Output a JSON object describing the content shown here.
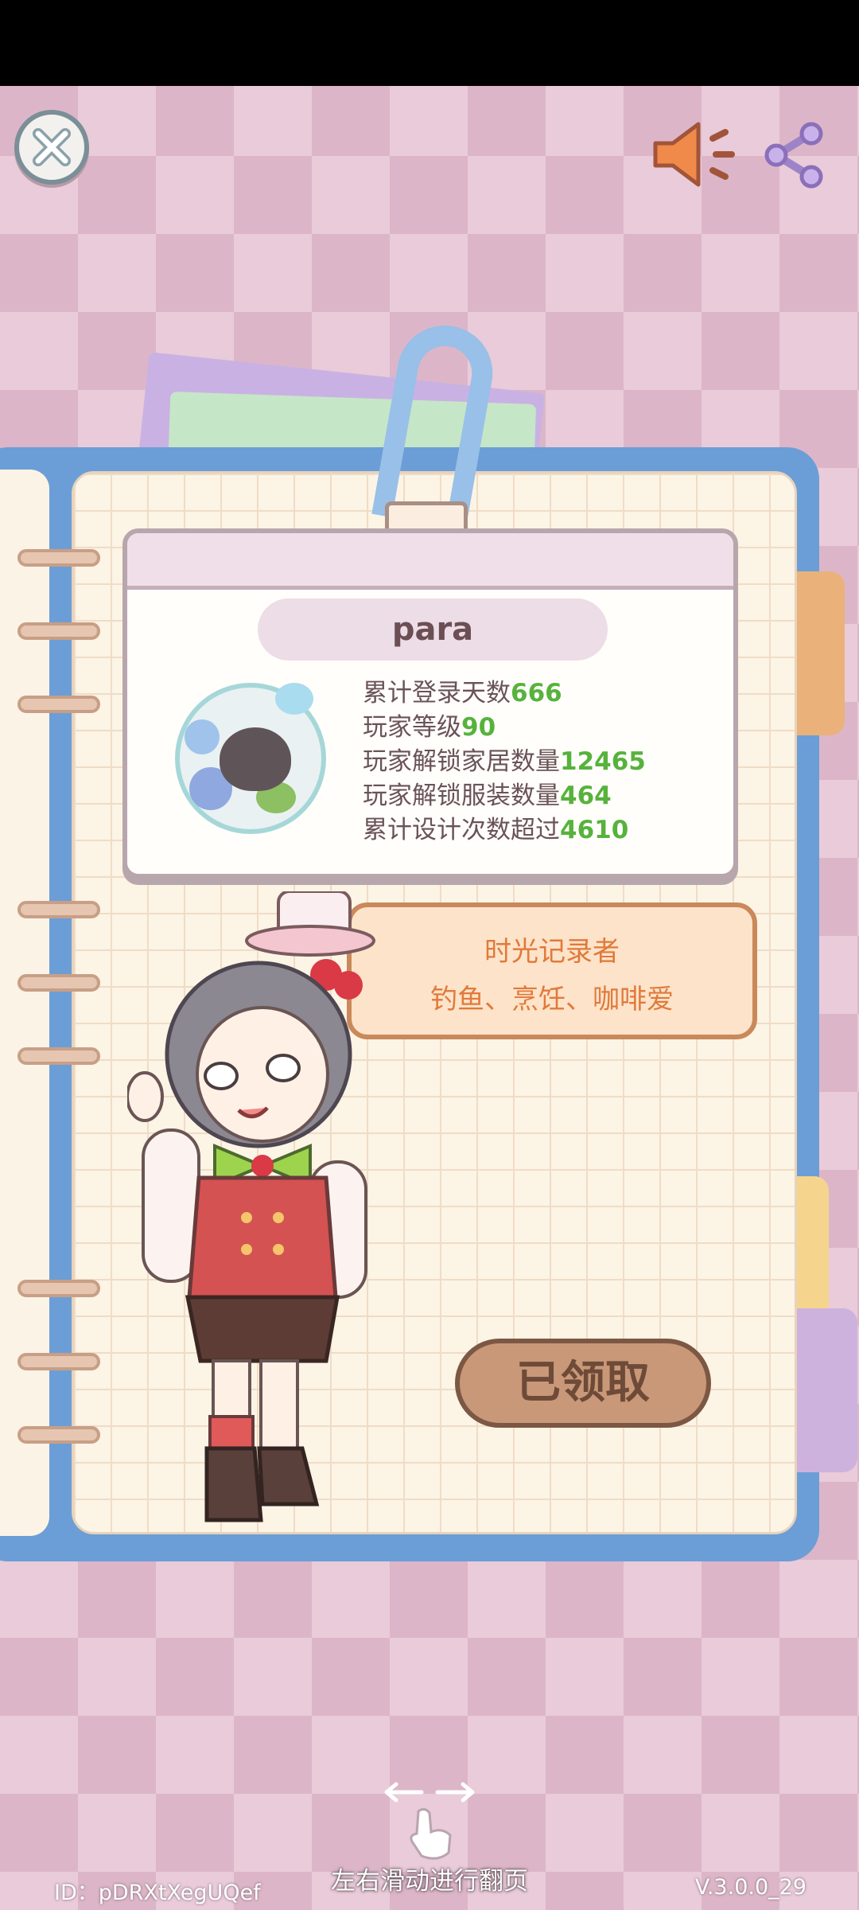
{
  "profile": {
    "player_name": "para",
    "stats": [
      {
        "label": "累计登录天数",
        "value": "666"
      },
      {
        "label": "玩家等级",
        "value": "90"
      },
      {
        "label": "玩家解锁家居数量",
        "value": "12465"
      },
      {
        "label": "玩家解锁服装数量",
        "value": "464"
      },
      {
        "label": "累计设计次数超过",
        "value": "4610"
      }
    ]
  },
  "title_banner": {
    "title": "时光记录者",
    "subtitle": "钓鱼、烹饪、咖啡爱"
  },
  "claim_button": {
    "label": "已领取"
  },
  "footer": {
    "swipe_hint": "左右滑动进行翻页",
    "player_id": "ID：pDRXtXegUQef",
    "version": "V.3.0.0_29"
  },
  "icons": {
    "close": "close-icon",
    "sound": "speaker-icon",
    "share": "share-icon",
    "swipe": "swipe-hand-icon"
  },
  "colors": {
    "stat_value": "#57b23c",
    "banner_text": "#e07a3b",
    "notebook_cover": "#6b9ed6"
  }
}
